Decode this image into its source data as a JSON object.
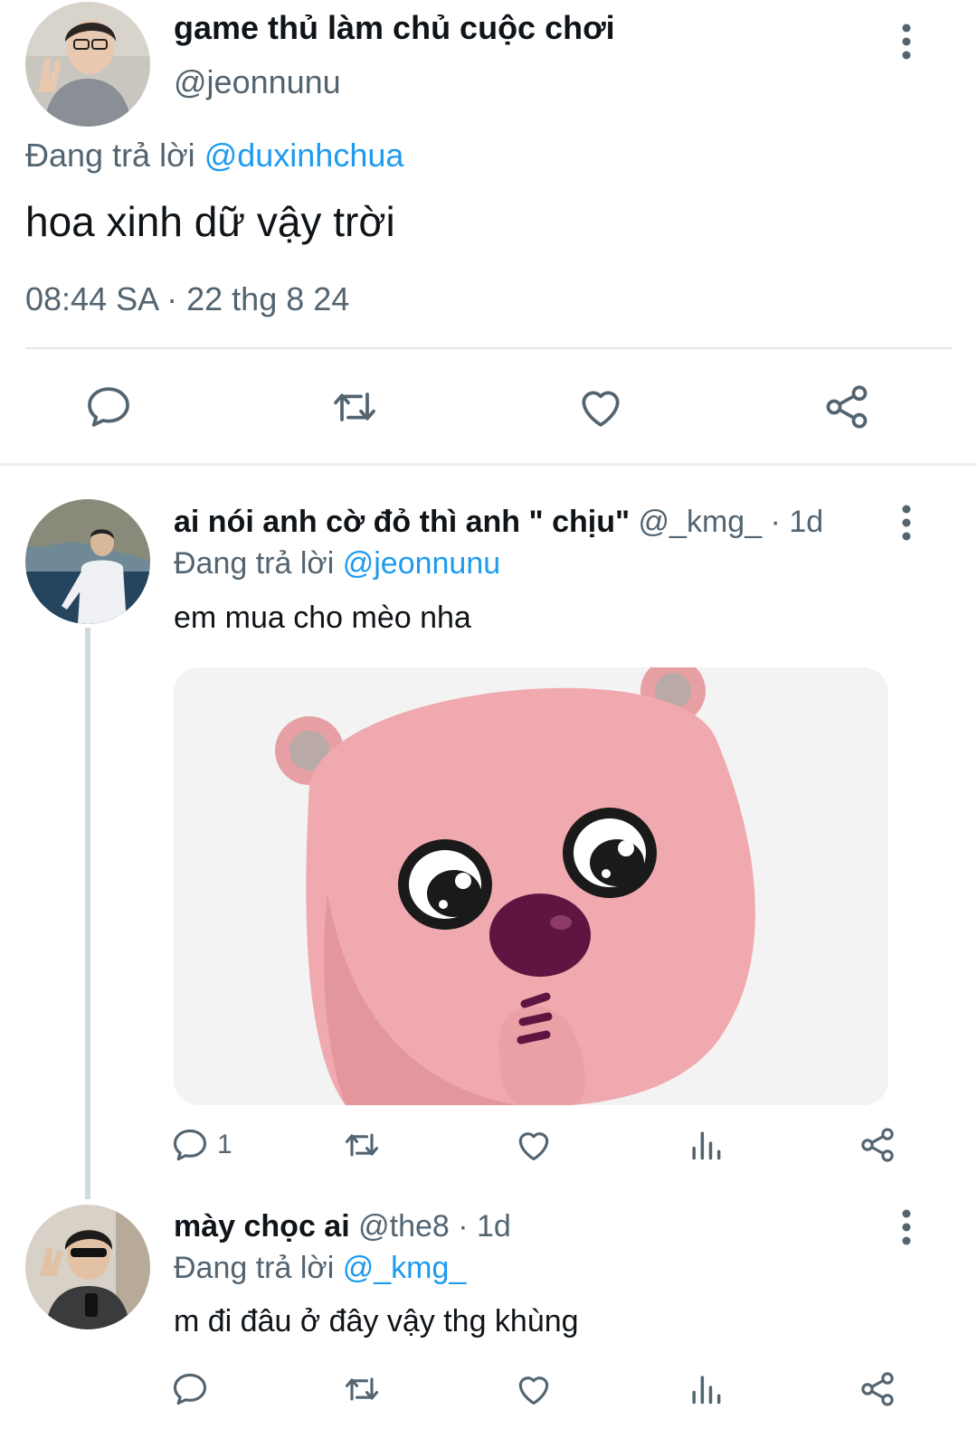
{
  "main_tweet": {
    "author_name": "game thủ làm chủ cuộc chơi",
    "author_handle": "@jeonnunu",
    "reply_prefix": "Đang trả lời",
    "reply_to": "@duxinhchua",
    "text": "hoa xinh dữ vậy trời",
    "timestamp": "08:44 SA · 22 thg 8 24"
  },
  "replies": [
    {
      "author_name": "ai nói anh cờ đỏ thì anh \" chịu\"",
      "meta": "@_kmg_ · 1d",
      "reply_prefix": "Đang trả lời",
      "reply_to": "@jeonnunu",
      "text": "em mua cho mèo nha",
      "reply_count": "1"
    },
    {
      "author_name": "mày chọc ai",
      "meta": "@the8 · 1d",
      "reply_prefix": "Đang trả lời",
      "reply_to": "@_kmg_",
      "text": "m đi đâu ở đây vậy thg khùng",
      "reply_count": ""
    }
  ],
  "icons": {
    "reply": "reply-bubble-icon",
    "retweet": "retweet-icon",
    "like": "heart-icon",
    "share": "share-icon",
    "views": "views-bar-chart-icon",
    "more": "more-vertical-icon"
  },
  "colors": {
    "accent": "#1d9bf0",
    "secondary_text": "#536471",
    "icon": "#536471",
    "divider": "#e4e8eb"
  }
}
